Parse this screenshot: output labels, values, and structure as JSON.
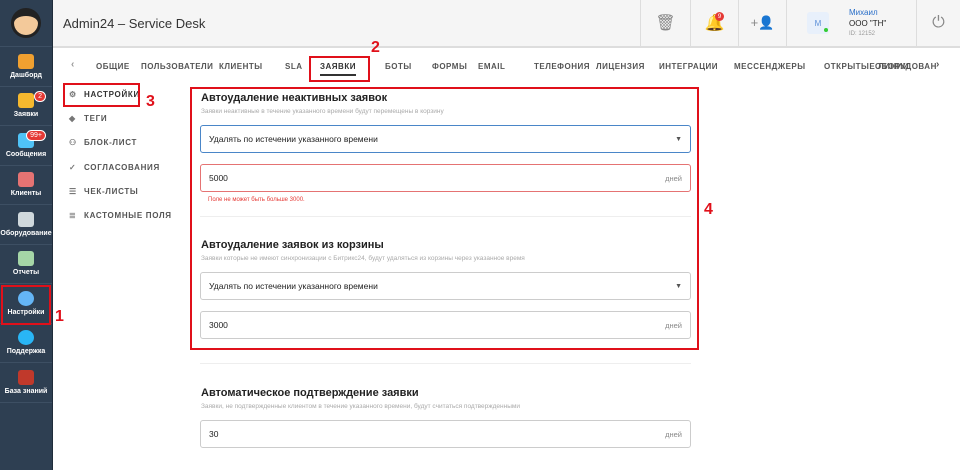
{
  "app": {
    "title": "Admin24 – Service Desk"
  },
  "sidebar": {
    "items": [
      {
        "label": "Дашборд",
        "icon": "dashboard-icon",
        "color": "#f0a030"
      },
      {
        "label": "Заявки",
        "icon": "megaphone-icon",
        "color": "#f5b82e",
        "badge": "2"
      },
      {
        "label": "Сообщения",
        "icon": "chat-icon",
        "color": "#4fc3f7",
        "badge": "99+"
      },
      {
        "label": "Клиенты",
        "icon": "clients-icon",
        "color": "#e57373"
      },
      {
        "label": "Оборудование",
        "icon": "equipment-icon",
        "color": "#cfd8dc"
      },
      {
        "label": "Отчеты",
        "icon": "reports-icon",
        "color": "#a5d6a7"
      },
      {
        "label": "Настройки",
        "icon": "gear-icon",
        "color": "#64b5f6"
      },
      {
        "label": "Поддержка",
        "icon": "help-icon",
        "color": "#29b6f6"
      },
      {
        "label": "База знаний",
        "icon": "book-icon",
        "color": "#c0392b"
      }
    ]
  },
  "header": {
    "notifications_badge": "9",
    "user": {
      "avatar_letter": "M",
      "name": "Михаил",
      "company": "ООО \"ТН\"",
      "id": "ID: 12152"
    }
  },
  "tabs": {
    "prev": "‹",
    "next": "›",
    "items": [
      "ОБЩИЕ",
      "ПОЛЬЗОВАТЕЛИ",
      "КЛИЕНТЫ",
      "SLA",
      "ЗАЯВКИ",
      "БОТЫ",
      "ФОРМЫ",
      "EMAIL",
      "ТЕЛЕФОНИЯ",
      "ЛИЦЕНЗИЯ",
      "ИНТЕГРАЦИИ",
      "МЕССЕНДЖЕРЫ",
      "ОТКРЫТЫЕ ЛИНИИ",
      "ОБОРУДОВАН"
    ],
    "active": "ЗАЯВКИ"
  },
  "subnav": {
    "items": [
      "НАСТРОЙКИ",
      "ТЕГИ",
      "БЛОК-ЛИСТ",
      "СОГЛАСОВАНИЯ",
      "ЧЕК-ЛИСТЫ",
      "КАСТОМНЫЕ ПОЛЯ"
    ],
    "active": "НАСТРОЙКИ"
  },
  "sections": [
    {
      "title": "Автоудаление неактивных заявок",
      "desc": "Заявки неактивные в течение указанного времени будут перемещены в корзину",
      "select": "Удалять по истечении указанного времени",
      "value": "5000",
      "unit": "дней",
      "error": "Поле не может быть больше 3000."
    },
    {
      "title": "Автоудаление заявок из корзины",
      "desc": "Заявки которые не имеют синхронизации с Битрикс24, будут удаляться из корзины через указанное время",
      "select": "Удалять по истечении указанного времени",
      "value": "3000",
      "unit": "дней"
    },
    {
      "title": "Автоматическое подтверждение заявки",
      "desc": "Заявки, не подтвержденные клиентом в течение указанного времени, будут считаться подтвержденными",
      "value": "30",
      "unit": "дней"
    }
  ],
  "annotations": [
    "1",
    "2",
    "3",
    "4"
  ],
  "colors": {
    "sidebar": "#2e3f52",
    "annotation": "#e0101a",
    "error": "#e53935",
    "focus": "#4a86c8"
  }
}
